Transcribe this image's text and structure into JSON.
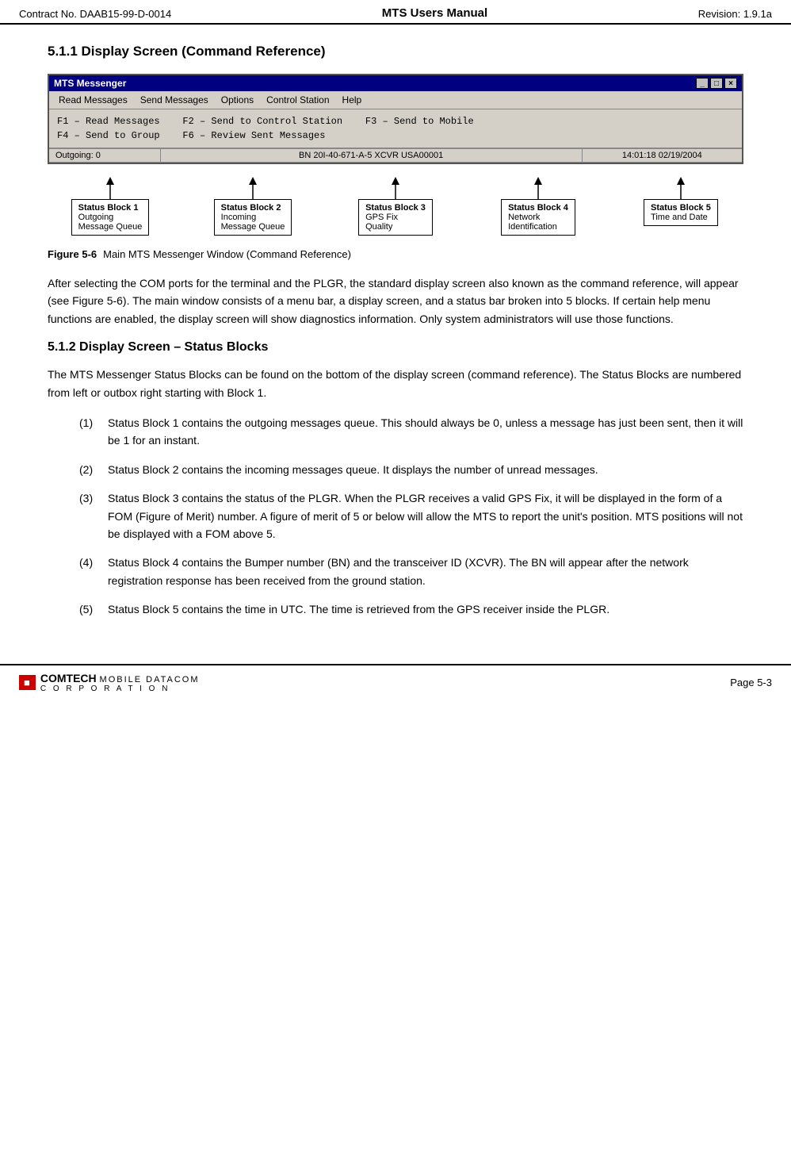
{
  "header": {
    "left": "Contract No. DAAB15-99-D-0014",
    "center": "MTS Users Manual",
    "right": "Revision:  1.9.1a"
  },
  "section": {
    "heading": "5.1.1  Display Screen (Command Reference)"
  },
  "mts_window": {
    "title": "MTS Messenger",
    "controls": [
      "-",
      "□",
      "×"
    ],
    "menu_items": [
      "Read Messages",
      "Send Messages",
      "Options",
      "Control Station",
      "Help"
    ],
    "shortcuts": [
      "F1 – Read Messages      F2 – Send to Control Station      F3 – Send to Mobile",
      "F4 – Send to Group      F6 – Review Sent Messages"
    ],
    "statusbar_text": "BN 20I-40-671-A-5  XCVR USA00001",
    "statusbar_time": "14:01:18 02/19/2004",
    "status_block_outgoing_value": "Outgoing: 0",
    "status_blocks": [
      {
        "id": "block1",
        "label": "Status Block 1",
        "line1": "Outgoing",
        "line2": "Message Queue"
      },
      {
        "id": "block2",
        "label": "Status Block 2",
        "line1": "Incoming",
        "line2": "Message Queue"
      },
      {
        "id": "block3",
        "label": "Status Block 3",
        "line1": "GPS Fix",
        "line2": "Quality"
      },
      {
        "id": "block4",
        "label": "Status Block 4",
        "line1": "Network",
        "line2": "Identification"
      },
      {
        "id": "block5",
        "label": "Status Block 5",
        "line1": "Time and Date",
        "line2": ""
      }
    ]
  },
  "figure": {
    "number": "Figure 5-6",
    "caption": "Main MTS Messenger Window (Command Reference)"
  },
  "body_paragraph": "After selecting the COM ports for the terminal and the PLGR, the standard display screen also known as the command reference, will appear (see Figure 5-6). The main window consists of a menu bar, a display screen, and a status bar broken into 5 blocks.  If certain help menu functions are enabled, the display screen will show diagnostics information.  Only system administrators will use those functions.",
  "subsection": {
    "heading": "5.1.2  Display Screen – Status Blocks"
  },
  "sub_paragraph": "The MTS Messenger Status Blocks can be found on the bottom of the display screen (command reference).  The Status Blocks are numbered from left or outbox right starting with Block 1.",
  "list_items": [
    {
      "num": "(1)",
      "text": "Status Block 1 contains the outgoing messages queue. This should always be 0, unless a message has just been sent, then it will be 1 for an instant."
    },
    {
      "num": "(2)",
      "text": "Status Block 2 contains the incoming messages queue. It displays the number of unread messages."
    },
    {
      "num": "(3)",
      "text": "Status Block 3 contains the status of the PLGR. When the PLGR receives a valid GPS Fix, it will be displayed in the form of a FOM (Figure of Merit) number. A figure of merit of 5 or below will allow the MTS to report the unit's position.  MTS positions will not be displayed with a FOM above 5."
    },
    {
      "num": "(4)",
      "text": "Status Block 4 contains the Bumper number (BN) and the transceiver ID (XCVR). The BN will appear after the network registration response has been received from the ground station."
    },
    {
      "num": "(5)",
      "text": "Status Block 5 contains the time in UTC. The time is retrieved from the GPS receiver inside the PLGR."
    }
  ],
  "footer": {
    "logo_text": "COMTECH",
    "company_line1": "MOBILE DATACOM",
    "company_line2": "C O R P O R A T I O N",
    "page": "Page 5-3"
  }
}
